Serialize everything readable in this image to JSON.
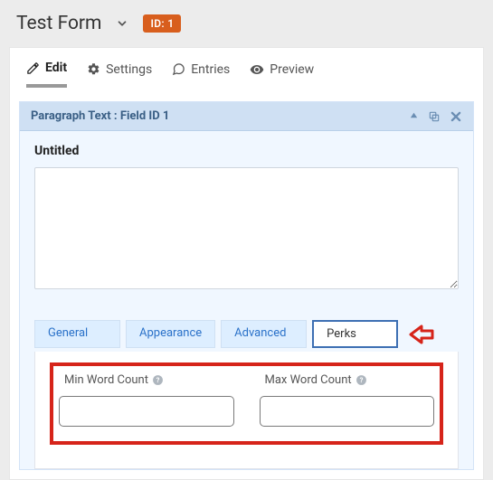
{
  "header": {
    "title": "Test Form",
    "id_badge": "ID: 1"
  },
  "tabs": {
    "edit": "Edit",
    "settings": "Settings",
    "entries": "Entries",
    "preview": "Preview"
  },
  "field": {
    "header_label": "Paragraph Text : Field ID 1",
    "title": "Untitled",
    "textarea_value": ""
  },
  "subtabs": {
    "general": "General",
    "appearance": "Appearance",
    "advanced": "Advanced",
    "perks": "Perks"
  },
  "perks_panel": {
    "min_label": "Min Word Count",
    "max_label": "Max Word Count",
    "min_value": "",
    "max_value": ""
  }
}
